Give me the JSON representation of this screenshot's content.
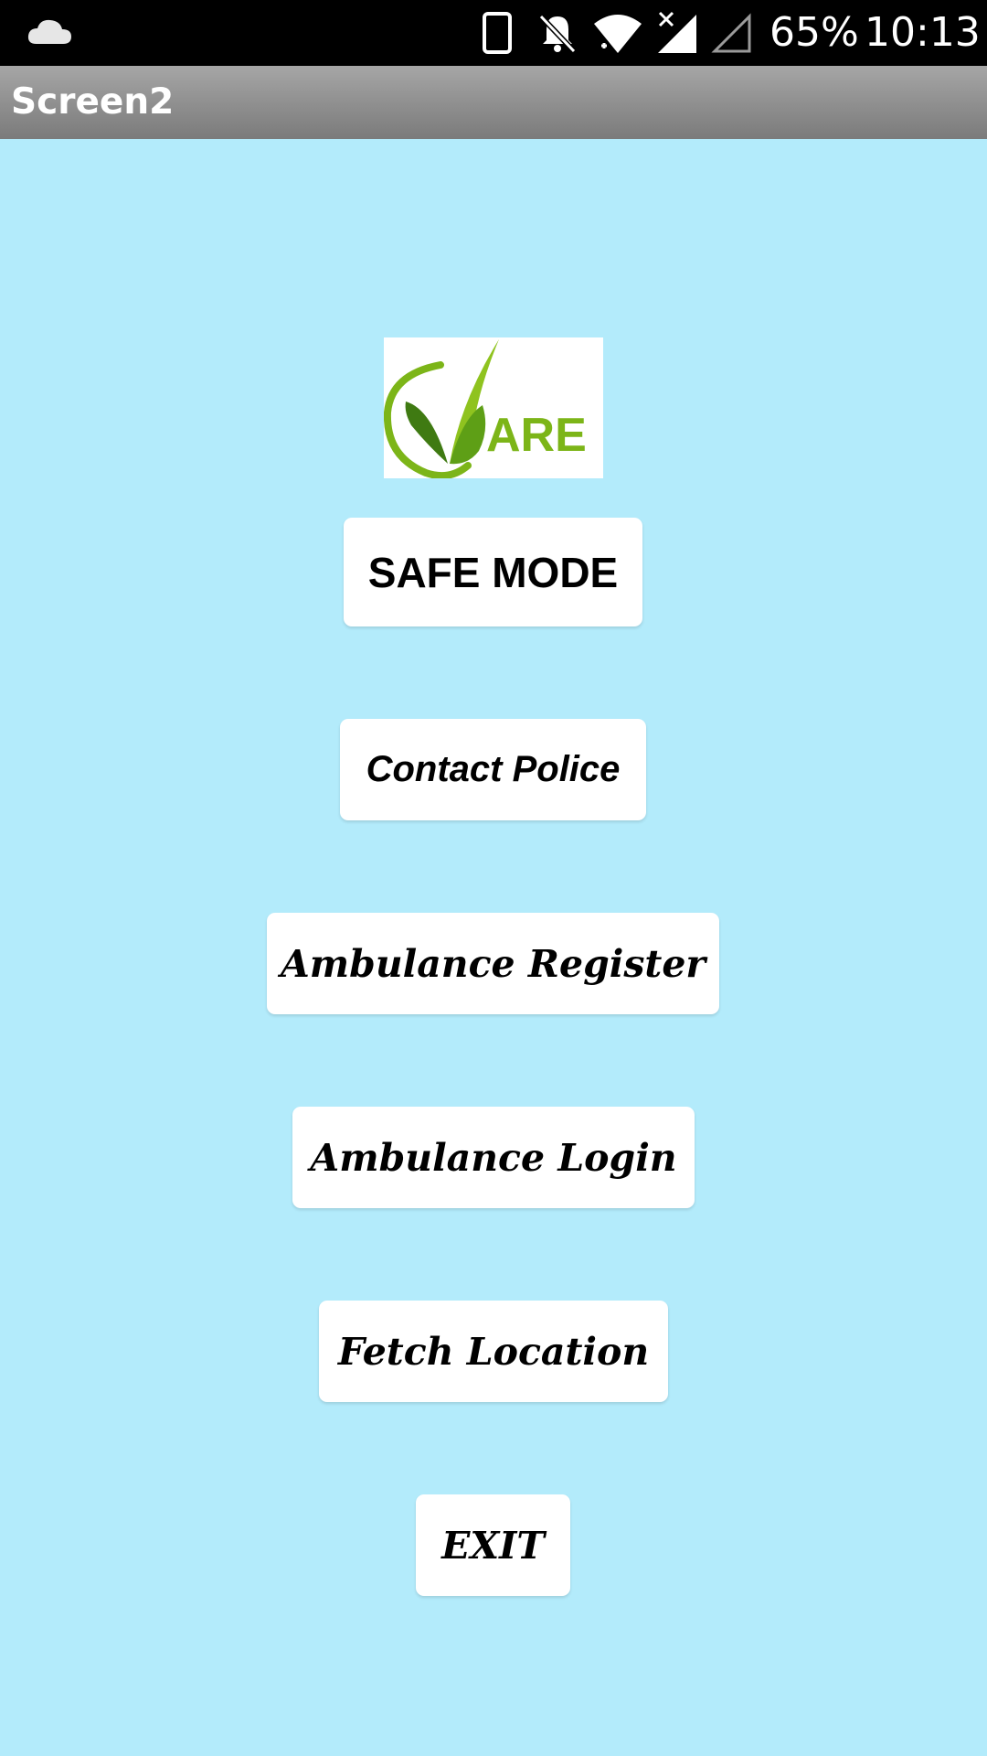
{
  "status_bar": {
    "battery": "65%",
    "time": "10:13",
    "icons": [
      "cloud-icon",
      "phone-icon",
      "bell-off-icon",
      "wifi-icon",
      "signal-no-data-icon",
      "signal-empty-icon"
    ]
  },
  "title_bar": {
    "title": "Screen2",
    "background": "#8e8e8e"
  },
  "logo": {
    "text": "ARE",
    "primary_color": "#7cb518",
    "dark_color": "#4a7f0f"
  },
  "buttons": {
    "safe_mode": "SAFE MODE",
    "contact_police": "Contact Police",
    "ambulance_register": "Ambulance Register",
    "ambulance_login": "Ambulance Login",
    "fetch_location": "Fetch Location",
    "exit": "EXIT"
  },
  "colors": {
    "background": "#b3ebfb",
    "button": "#ffffff",
    "status_bar": "#000000"
  }
}
